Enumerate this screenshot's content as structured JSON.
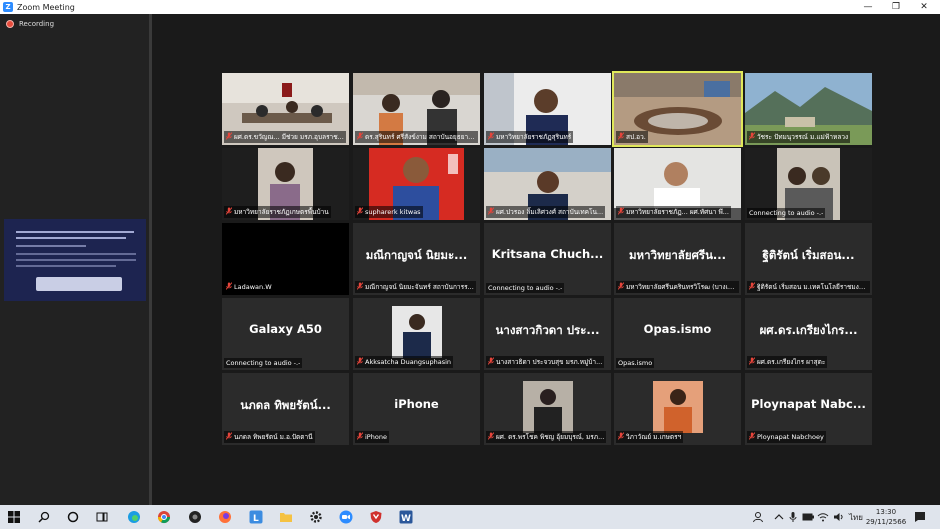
{
  "window": {
    "title": "Zoom Meeting",
    "logo_letter": "Z",
    "minimize": "—",
    "restore": "❐",
    "close": "✕"
  },
  "recording": {
    "label": "Recording"
  },
  "tiles": [
    {
      "caption": "ผศ.ดร.ขวัญณ... มีช่วย มรภ.อุบลราช...",
      "type": "video"
    },
    {
      "caption": "ดร.สุรินทร์ ศรีสังข์งาม สถาบันอยุธยาศึกษ...",
      "type": "video"
    },
    {
      "caption": "มหาวิทยาลัยราชภัฏสุรินทร์",
      "type": "video"
    },
    {
      "caption": "สป.อว.",
      "type": "video"
    },
    {
      "caption": "วัชระ ปัทมนุวรรณ์ ม.แม่ฟ้าหลวง",
      "type": "video"
    },
    {
      "caption": "มหาวิทยาลัยราชภัฏเกษตรพื้นบ้าน",
      "type": "video"
    },
    {
      "caption": "supharerk kitwas",
      "type": "video"
    },
    {
      "caption": "ผศ.ปวรอง ลิ้มเลิศวงศ์ สถาบันเทคโน...",
      "type": "video"
    },
    {
      "caption": "มหาวิทยาลัยราชภัฏ... ผศ.ทัศนา พึ...",
      "type": "video"
    },
    {
      "caption": "Connecting to audio -.-",
      "type": "video"
    },
    {
      "caption": "Ladawan.W",
      "type": "black"
    },
    {
      "name": "มณีกาญจน์ นิยมะ...",
      "caption": "มณีกาญจน์ นิยมะจันทร์ สถาบันการร...",
      "type": "name"
    },
    {
      "name": "Kritsana  Chuch...",
      "caption": "Connecting to audio -.-",
      "type": "name"
    },
    {
      "name": "มหาวิทยาลัยศรีน...",
      "caption": "มหาวิทยาลัยศรีนครินทรวิโรฒ (บางเข...",
      "type": "name"
    },
    {
      "name": "ฐิติรัตน์ เริ่มสอน...",
      "caption": "ฐิติรัตน์ เริ่มสอน ม.เทคโนโลยีราชมงค...",
      "type": "name"
    },
    {
      "name": "Galaxy A50",
      "caption": "Connecting to audio -.-",
      "type": "name"
    },
    {
      "caption": "Akksatcha Duangsuphasin",
      "type": "video"
    },
    {
      "name": "นางสาวกิวดา ประ...",
      "caption": "นางสาวธิดา ประจวบสุข มรภ.หมู่บ้า...",
      "type": "name"
    },
    {
      "name": "Opas.ismo",
      "caption": "Opas.ismo",
      "type": "name"
    },
    {
      "name": "ผศ.ดร.เกรียงไกร...",
      "caption": "ผศ.ดร.เกรียงไกร ผาสุตะ",
      "type": "name"
    },
    {
      "name": "นภดล ทิพยรัตน์...",
      "caption": "นภดล ทิพยรัตน์ ม.อ.ปัตตานี",
      "type": "name"
    },
    {
      "name": "iPhone",
      "caption": "iPhone",
      "type": "name"
    },
    {
      "caption": "ผศ. ดร.พรโชค พิชญ อุ้ยมบุรณ์, มรภ...",
      "type": "video"
    },
    {
      "caption": "วิภาวัณย์ ม.เกษตรฯ",
      "type": "video"
    },
    {
      "name": "Ploynapat  Nabc...",
      "caption": "Ploynapat Nabchoey",
      "type": "name"
    }
  ],
  "taskbar": {
    "time": "13:30",
    "date": "29/11/2566",
    "lang": "ไทย"
  }
}
